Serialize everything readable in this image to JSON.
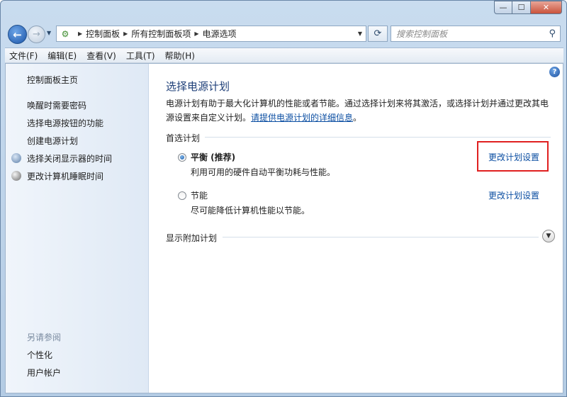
{
  "window": {
    "minimize": "—",
    "maximize": "☐",
    "close": "✕"
  },
  "navbar": {
    "breadcrumbs": [
      "控制面板",
      "所有控制面板项",
      "电源选项"
    ],
    "search_placeholder": "搜索控制面板"
  },
  "menu": [
    "文件(F)",
    "编辑(E)",
    "查看(V)",
    "工具(T)",
    "帮助(H)"
  ],
  "sidebar": {
    "home": "控制面板主页",
    "links": [
      "唤醒时需要密码",
      "选择电源按钮的功能",
      "创建电源计划"
    ],
    "icon_links": [
      "选择关闭显示器的时间",
      "更改计算机睡眠时间"
    ],
    "see_also_header": "另请参阅",
    "see_also": [
      "个性化",
      "用户帐户"
    ]
  },
  "main": {
    "title": "选择电源计划",
    "description": "电源计划有助于最大化计算机的性能或者节能。通过选择计划来将其激活，或选择计划并通过更改其电源设置来自定义计划。",
    "description_link": "请提供电源计划的详细信息",
    "description_end": "。",
    "preferred_label": "首选计划",
    "plans": [
      {
        "name": "平衡 (推荐)",
        "desc": "利用可用的硬件自动平衡功耗与性能。",
        "link": "更改计划设置",
        "selected": true
      },
      {
        "name": "节能",
        "desc": "尽可能降低计算机性能以节能。",
        "link": "更改计划设置",
        "selected": false
      }
    ],
    "additional_label": "显示附加计划"
  },
  "colors": {
    "link": "#0b4ea2",
    "title": "#1e3f78",
    "highlight": "#e02020"
  }
}
